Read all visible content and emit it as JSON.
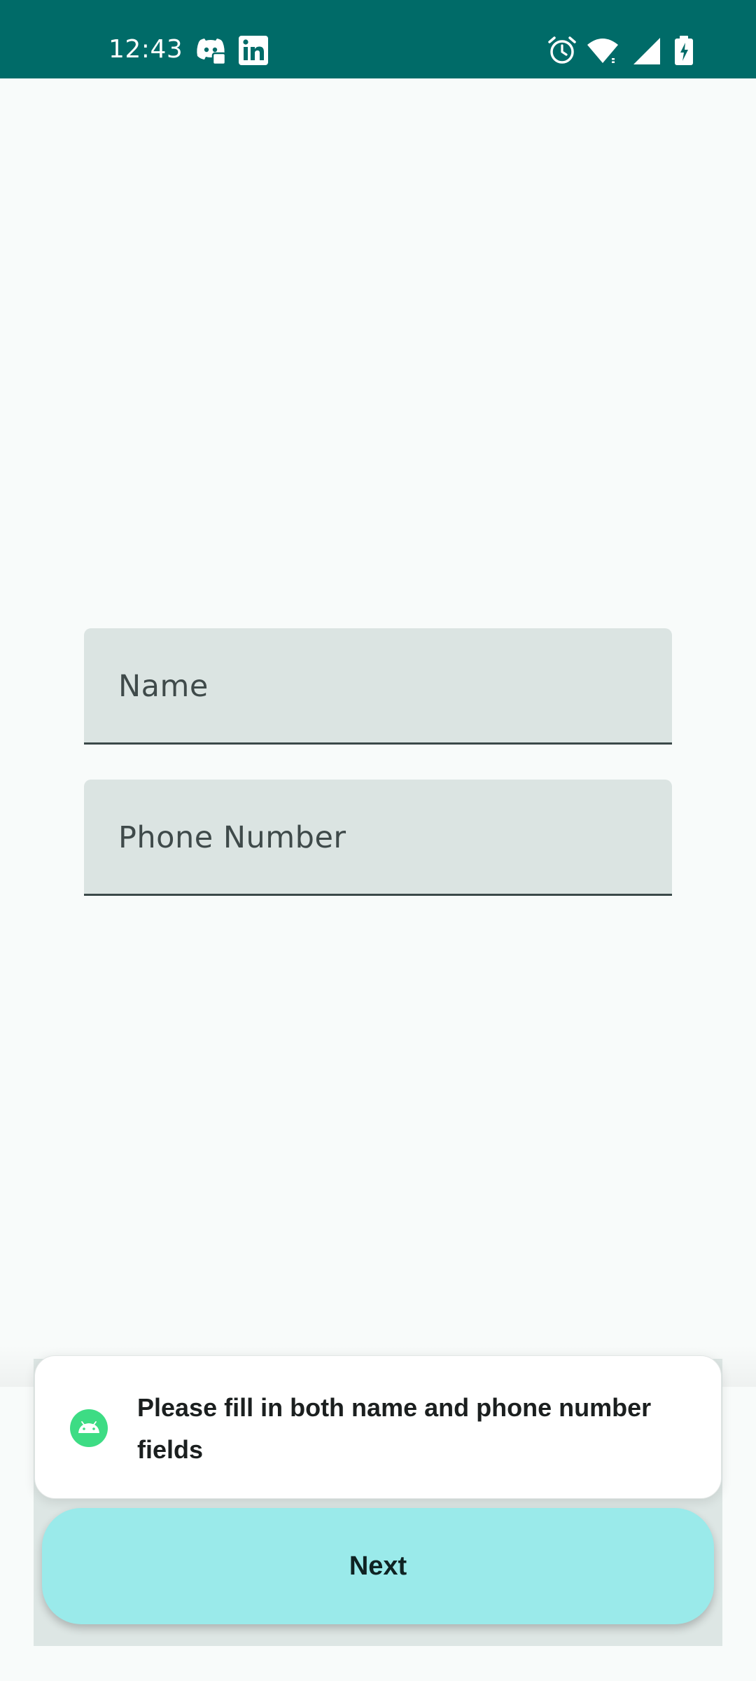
{
  "status_bar": {
    "time": "12:43",
    "notification_icons": [
      "discord-icon",
      "linkedin-icon"
    ],
    "system_icons": [
      "alarm-icon",
      "wifi-icon",
      "signal-icon",
      "battery-charging-icon"
    ],
    "background_color": "#006b68"
  },
  "form": {
    "name_placeholder": "Name",
    "phone_placeholder": "Phone Number",
    "name_value": "",
    "phone_value": "",
    "field_fill_color": "#dbe4e2"
  },
  "toast": {
    "message": "Please fill in both name and phone number fields",
    "icon": "android-icon",
    "icon_color": "#3ddc84"
  },
  "actions": {
    "next_label": "Next",
    "next_color": "#9aeaea"
  }
}
